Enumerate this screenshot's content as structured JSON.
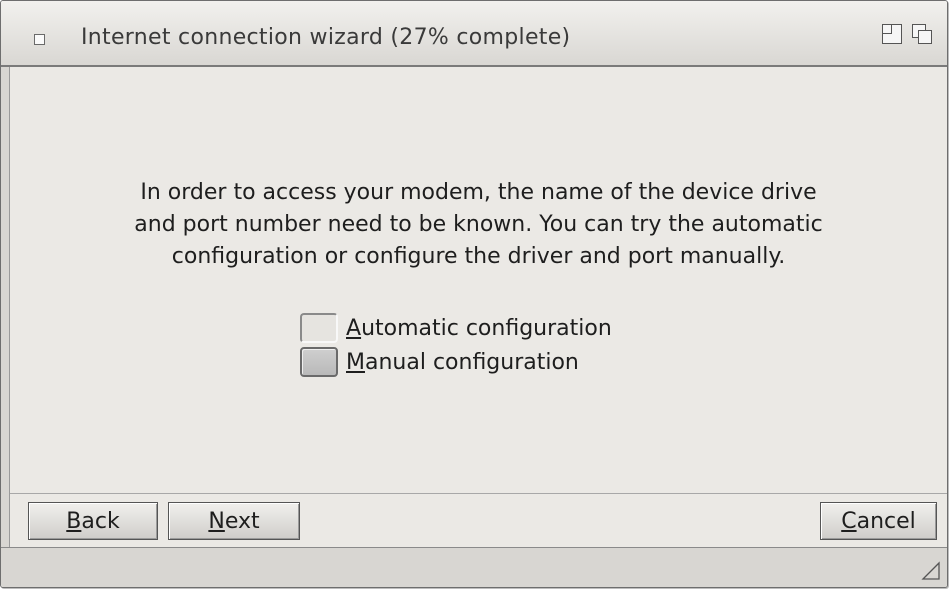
{
  "window": {
    "title": "Internet connection wizard (27% complete)",
    "progress_percent": 27
  },
  "titlebar_icons": [
    "close-box-icon",
    "toggle-size-icon",
    "back-to-front-icon"
  ],
  "message": {
    "line1": "In order to access your modem, the name of the device drive",
    "line2": "and port number need to be known. You can try the automatic",
    "line3": "configuration or configure the driver and port manually."
  },
  "options": [
    {
      "mnemonic": "A",
      "rest": "utomatic configuration",
      "selected": false
    },
    {
      "mnemonic": "M",
      "rest": "anual configuration",
      "selected": true
    }
  ],
  "buttons": {
    "back": {
      "mnemonic": "B",
      "rest": "ack"
    },
    "next": {
      "mnemonic": "N",
      "rest": "ext"
    },
    "cancel": {
      "mnemonic": "C",
      "rest": "ancel"
    }
  },
  "colors": {
    "background": "#ebe9e5",
    "titlebar": "#e4e2de",
    "text": "#1e1e1e"
  }
}
